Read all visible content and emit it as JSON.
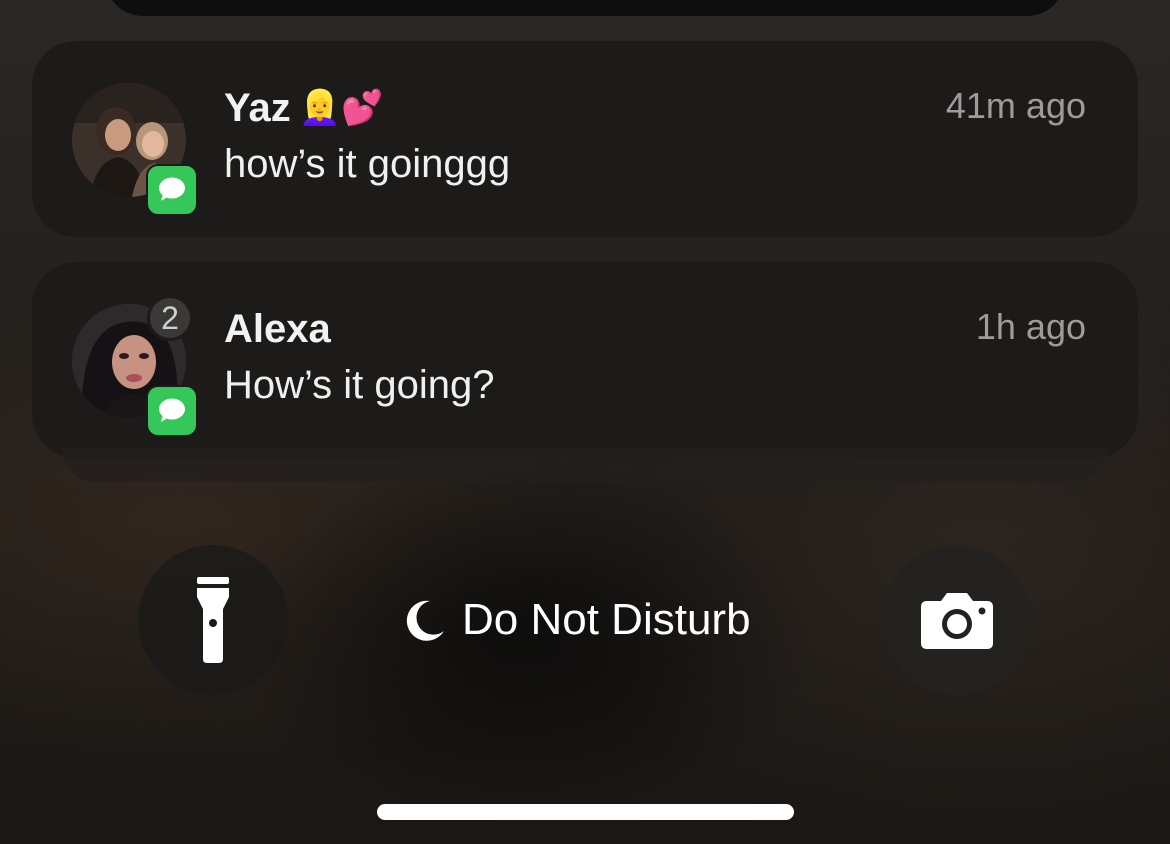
{
  "notifications": [
    {
      "sender": "Yaz",
      "sender_emoji": "👱‍♀️💕",
      "message": "how’s it goinggg",
      "time": "41m ago",
      "app_icon": "messages-icon"
    },
    {
      "sender": "Alexa",
      "message": "How’s it going?",
      "time": "1h ago",
      "count": "2",
      "app_icon": "messages-icon"
    }
  ],
  "quick_actions": {
    "left_icon": "flashlight-icon",
    "right_icon": "camera-icon"
  },
  "focus": {
    "icon": "moon-icon",
    "label": "Do Not Disturb"
  },
  "colors": {
    "app_badge": "#35c759",
    "card": "#1c1b1a",
    "secondary_text": "#9d9c9b"
  }
}
